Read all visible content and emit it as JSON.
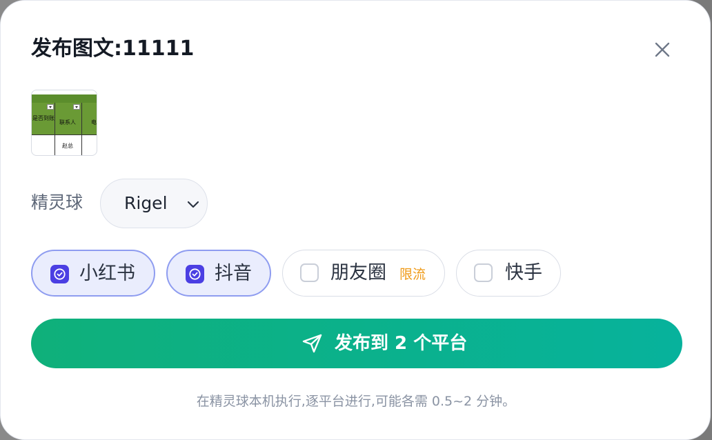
{
  "dialog": {
    "title": "发布图文:11111"
  },
  "thumbnail": {
    "cells": [
      "是否到账",
      "联系人",
      "电",
      "赵总"
    ]
  },
  "spirit": {
    "label": "精灵球",
    "selected": "Rigel"
  },
  "platforms": [
    {
      "label": "小红书",
      "checked": true
    },
    {
      "label": "抖音",
      "checked": true
    },
    {
      "label": "朋友圈",
      "checked": false,
      "badge": "限流"
    },
    {
      "label": "快手",
      "checked": false
    }
  ],
  "publish": {
    "label": "发布到 2 个平台"
  },
  "hint": "在精灵球本机执行,逐平台进行,可能各需 0.5~2 分钟。",
  "colors": {
    "accent_gradient_start": "#0fb07a",
    "accent_gradient_end": "#07b29c",
    "checkbox_checked": "#4b3fe3",
    "chip_selected_bg": "#eaedfd",
    "badge": "#ef9a17"
  },
  "icons": {
    "close": "close-icon",
    "chevron": "chevron-down-icon",
    "check": "check-circle-icon",
    "send": "send-icon"
  }
}
